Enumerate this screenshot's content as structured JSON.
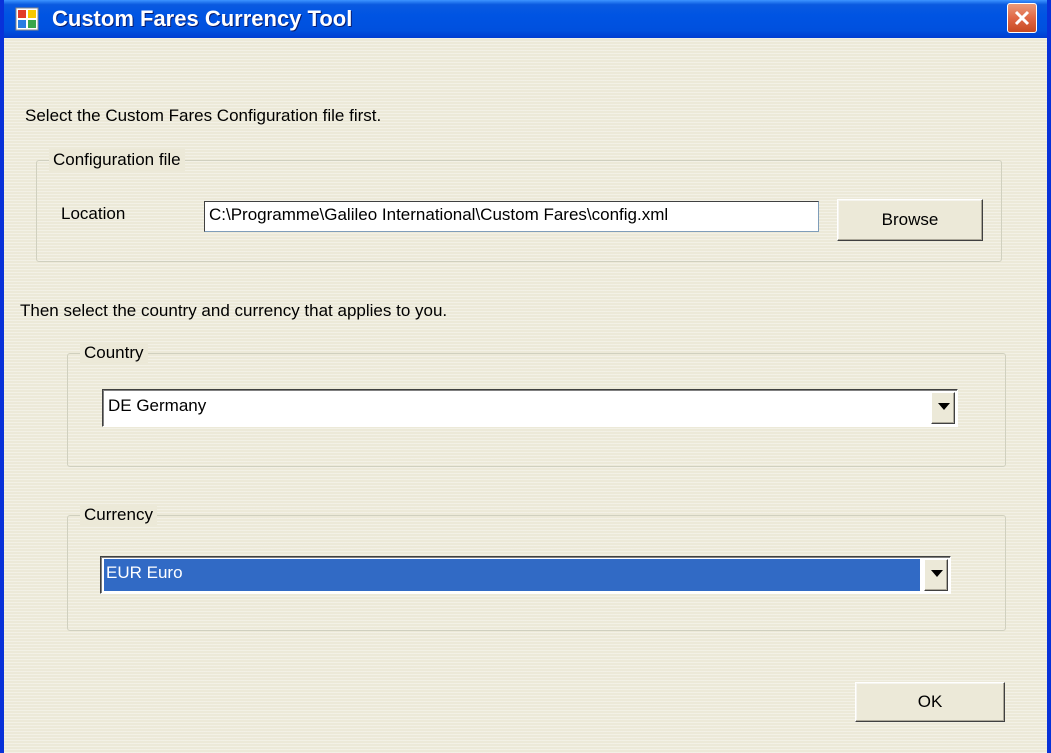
{
  "window": {
    "title": "Custom Fares Currency Tool"
  },
  "instructions": {
    "first": "Select the Custom Fares Configuration file first.",
    "second": "Then select the country and currency that applies to you."
  },
  "config_group": {
    "legend": "Configuration file",
    "location_label": "Location",
    "location_value": "C:\\Programme\\Galileo International\\Custom Fares\\config.xml",
    "browse_label": "Browse"
  },
  "country_group": {
    "legend": "Country",
    "selected": "DE Germany"
  },
  "currency_group": {
    "legend": "Currency",
    "selected": "EUR Euro"
  },
  "buttons": {
    "ok_label": "OK"
  },
  "colors": {
    "titlebar": "#0054e3",
    "selection": "#316ac5",
    "close": "#e06745"
  }
}
